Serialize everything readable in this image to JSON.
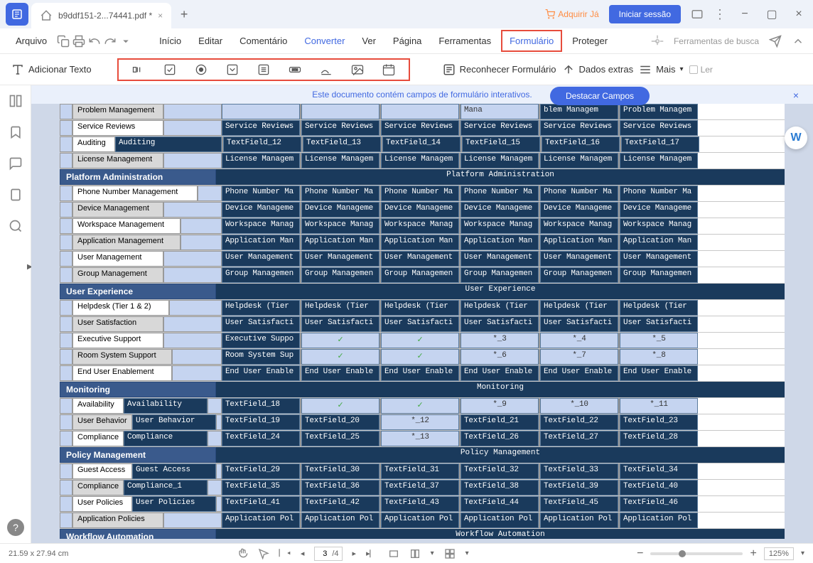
{
  "title": {
    "tab": "b9ddf151-2...74441.pdf *"
  },
  "header": {
    "adquirir": "Adquirir Já",
    "iniciar": "Iniciar sessão"
  },
  "menu": {
    "arquivo": "Arquivo",
    "inicio": "Início",
    "editar": "Editar",
    "comentario": "Comentário",
    "converter": "Converter",
    "ver": "Ver",
    "pagina": "Página",
    "ferramentas": "Ferramentas",
    "formulario": "Formulário",
    "proteger": "Proteger",
    "busca": "Ferramentas de busca"
  },
  "toolbar": {
    "adicionar": "Adicionar Texto",
    "reconhecer": "Reconhecer Formulário",
    "dados": "Dados extras",
    "mais": "Mais",
    "ler": "Ler"
  },
  "banner": {
    "msg": "Este documento contém campos de formulário interativos.",
    "destacar": "Destacar Campos"
  },
  "sections": {
    "platform": "Platform Administration",
    "platform_ff": "Platform Administration",
    "ux": "User Experience",
    "ux_ff": "User Experience",
    "monitoring": "Monitoring",
    "monitoring_ff": "Monitoring",
    "policy": "Policy Management",
    "policy_ff": "Policy Management",
    "workflow": "Workflow Automation",
    "workflow_ff": "Workflow Automation"
  },
  "rows": [
    {
      "lbl": "Problem Management",
      "gray": true,
      "wmain": 128,
      "cells": [
        "",
        "",
        "",
        "",
        "blem Managem",
        "Problem Managem"
      ],
      "special": "partial"
    },
    {
      "lbl": "Service Reviews",
      "wmain": 128,
      "cells": [
        "Service Reviews",
        "Service Reviews",
        "Service Reviews",
        "Service Reviews",
        "Service Reviews",
        "Service Reviews"
      ]
    },
    {
      "lbl": "Auditing",
      "wmain": 60,
      "ff0": "Auditing",
      "ff0w": 150,
      "cells": [
        "TextField_12",
        "TextField_13",
        "TextField_14",
        "TextField_15",
        "TextField_16",
        "TextField_17"
      ]
    },
    {
      "lbl": "License Management",
      "gray": true,
      "wmain": 128,
      "cells": [
        "License Managem",
        "License Managem",
        "License Managem",
        "License Managem",
        "License Managem",
        "License Managem"
      ]
    },
    {
      "section": "platform"
    },
    {
      "lbl": "Phone Number Management",
      "wmain": 176,
      "cells": [
        "Phone Number Ma",
        "Phone Number Ma",
        "Phone Number Ma",
        "Phone Number Ma",
        "Phone Number Ma",
        "Phone Number Ma"
      ]
    },
    {
      "lbl": "Device Management",
      "gray": true,
      "wmain": 128,
      "cells": [
        "Device Manageme",
        "Device Manageme",
        "Device Manageme",
        "Device Manageme",
        "Device Manageme",
        "Device Manageme"
      ]
    },
    {
      "lbl": "Workspace Management",
      "wmain": 152,
      "cells": [
        "Workspace Manag",
        "Workspace Manag",
        "Workspace Manag",
        "Workspace Manag",
        "Workspace Manag",
        "Workspace Manag"
      ]
    },
    {
      "lbl": "Application Management",
      "gray": true,
      "wmain": 152,
      "cells": [
        "Application Man",
        "Application Man",
        "Application Man",
        "Application Man",
        "Application Man",
        "Application Man"
      ]
    },
    {
      "lbl": "User Management",
      "wmain": 128,
      "cells": [
        "User Management",
        "User Management",
        "User Management",
        "User Management",
        "User Management",
        "User Management"
      ]
    },
    {
      "lbl": "Group Management",
      "gray": true,
      "wmain": 128,
      "cells": [
        "Group Managemen",
        "Group Managemen",
        "Group Managemen",
        "Group Managemen",
        "Group Managemen",
        "Group Managemen"
      ]
    },
    {
      "section": "ux"
    },
    {
      "lbl": "Helpdesk (Tier 1 & 2)",
      "wmain": 136,
      "cells": [
        "Helpdesk (Tier",
        "Helpdesk (Tier",
        "Helpdesk (Tier",
        "Helpdesk (Tier",
        "Helpdesk (Tier",
        "Helpdesk (Tier"
      ]
    },
    {
      "lbl": "User Satisfaction",
      "gray": true,
      "wmain": 128,
      "cells": [
        "User Satisfacti",
        "User Satisfacti",
        "User Satisfacti",
        "User Satisfacti",
        "User Satisfacti",
        "User Satisfacti"
      ]
    },
    {
      "lbl": "Executive Support",
      "wmain": 128,
      "c0": "Executive Suppo",
      "checkboxes": [
        1,
        2
      ],
      "stars": [
        "*_3",
        "*_4",
        "*_5"
      ]
    },
    {
      "lbl": "Room System Support",
      "gray": true,
      "wmain": 140,
      "c0": "Room System Sup",
      "checkboxes": [
        1,
        2
      ],
      "stars": [
        "*_6",
        "*_7",
        "*_8"
      ]
    },
    {
      "lbl": "End User Enablement",
      "wmain": 140,
      "cells": [
        "End User Enable",
        "End User Enable",
        "End User Enable",
        "End User Enable",
        "End User Enable",
        "End User Enable"
      ]
    },
    {
      "section": "monitoring"
    },
    {
      "lbl": "Availability",
      "wmain": 72,
      "ff0": "Availability",
      "ff0w": 118,
      "c0": "TextField_18",
      "checkboxes": [
        1,
        2
      ],
      "stars": [
        "*_9",
        "*_10",
        "*_11"
      ]
    },
    {
      "lbl": "User Behavior",
      "gray": true,
      "wmain": 84,
      "ff0": "User Behavior",
      "ff0w": 118,
      "cells": [
        "TextField_19",
        "TextField_20",
        "*_12",
        "TextField_21",
        "TextField_22",
        "TextField_23"
      ],
      "starIdx": [
        2
      ]
    },
    {
      "lbl": "Compliance",
      "wmain": 72,
      "ff0": "Compliance",
      "ff0w": 118,
      "cells": [
        "TextField_24",
        "TextField_25",
        "*_13",
        "TextField_26",
        "TextField_27",
        "TextField_28"
      ],
      "starIdx": [
        2
      ]
    },
    {
      "section": "policy"
    },
    {
      "lbl": "Guest Access",
      "wmain": 84,
      "ff0": "Guest Access",
      "ff0w": 118,
      "cells": [
        "TextField_29",
        "TextField_30",
        "TextField_31",
        "TextField_32",
        "TextField_33",
        "TextField_34"
      ]
    },
    {
      "lbl": "Compliance",
      "gray": true,
      "wmain": 72,
      "ff0": "Compliance_1",
      "ff0w": 118,
      "cells": [
        "TextField_35",
        "TextField_36",
        "TextField_37",
        "TextField_38",
        "TextField_39",
        "TextField_40"
      ]
    },
    {
      "lbl": "User Policies",
      "wmain": 84,
      "ff0": "User Policies",
      "ff0w": 118,
      "cells": [
        "TextField_41",
        "TextField_42",
        "TextField_43",
        "TextField_44",
        "TextField_45",
        "TextField_46"
      ]
    },
    {
      "lbl": "Application Policies",
      "gray": true,
      "wmain": 128,
      "cells": [
        "Application Pol",
        "Application Pol",
        "Application Pol",
        "Application Pol",
        "Application Pol",
        "Application Pol"
      ]
    },
    {
      "section": "workflow"
    }
  ],
  "status": {
    "dim": "21.59 x 27.94 cm",
    "page": "3",
    "total": "/4",
    "zoom": "125%"
  }
}
